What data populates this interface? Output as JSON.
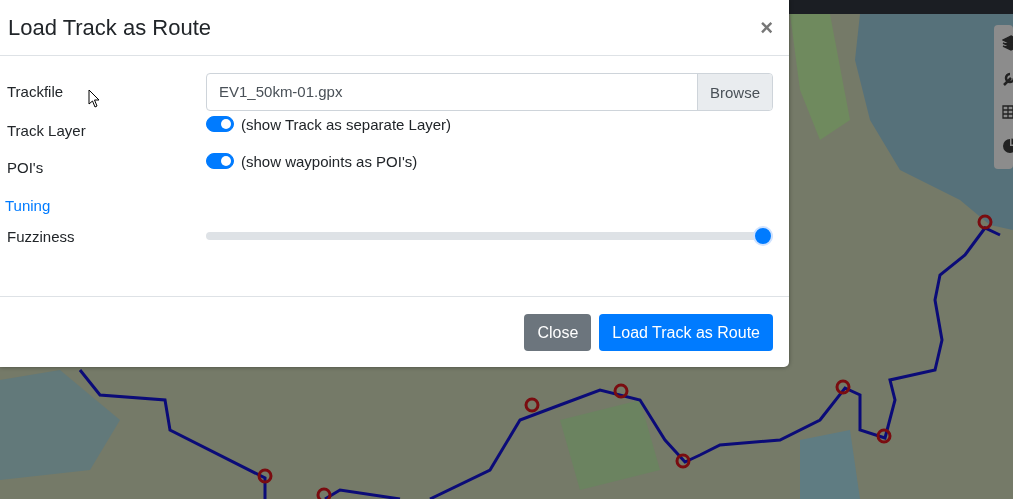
{
  "dialog": {
    "title": "Load Track as Route",
    "close_glyph": "×",
    "fields": [
      {
        "kind": "file",
        "label": "Trackfile",
        "value": "EV1_50km-01.gpx",
        "button": "Browse"
      },
      {
        "kind": "switch",
        "label": "Track Layer",
        "on": true,
        "caption": "(show Track as separate Layer)"
      },
      {
        "kind": "switch",
        "label": "POI's",
        "on": true,
        "caption": "(show waypoints as POI's)"
      },
      {
        "kind": "heading",
        "label": "Tuning"
      },
      {
        "kind": "slider",
        "label": "Fuzziness",
        "level": 1
      }
    ],
    "buttons": [
      {
        "kind": "secondary",
        "label": "Close"
      },
      {
        "kind": "primary",
        "label": "Load Track as Route"
      }
    ]
  }
}
